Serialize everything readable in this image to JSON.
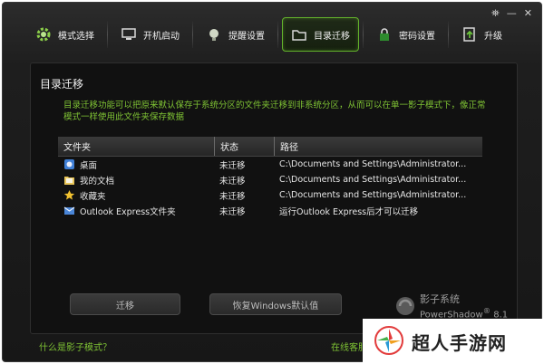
{
  "window_controls": {
    "menu": "⛯",
    "minimize": "—",
    "close": "✕"
  },
  "toolbar": {
    "items": [
      {
        "label": "模式选择",
        "icon": "gear-icon"
      },
      {
        "label": "开机启动",
        "icon": "monitor-icon"
      },
      {
        "label": "提醒设置",
        "icon": "bulb-icon"
      },
      {
        "label": "目录迁移",
        "icon": "folder-icon",
        "active": true
      },
      {
        "label": "密码设置",
        "icon": "lock-icon"
      },
      {
        "label": "升级",
        "icon": "upgrade-icon"
      }
    ]
  },
  "panel": {
    "title": "目录迁移",
    "description": "目录迁移功能可以把原来默认保存于系统分区的文件夹迁移到非系统分区，从而可以在单一影子模式下，像正常模式一样使用此文件夹保存数据"
  },
  "table": {
    "columns": [
      "文件夹",
      "状态",
      "路径"
    ],
    "rows": [
      {
        "name": "桌面",
        "status": "未迁移",
        "path": "C:\\Documents and Settings\\Administrator...",
        "icon": "desktop-icon"
      },
      {
        "name": "我的文档",
        "status": "未迁移",
        "path": "C:\\Documents and Settings\\Administrator...",
        "icon": "documents-icon"
      },
      {
        "name": "收藏夹",
        "status": "未迁移",
        "path": "C:\\Documents and Settings\\Administrator...",
        "icon": "star-icon"
      },
      {
        "name": "Outlook Express文件夹",
        "status": "未迁移",
        "path": "运行Outlook Express后才可以迁移",
        "icon": "outlook-icon"
      }
    ]
  },
  "buttons": {
    "migrate": "迁移",
    "restore": "恢复Windows默认值"
  },
  "brand": {
    "name_cn": "影子系统",
    "name_en": "PowerShadow",
    "version": "8.1",
    "mark": "®"
  },
  "footer": {
    "left_link": "什么是影子模式？",
    "right_link": "在线客服"
  },
  "watermark": {
    "text": "超人手游网"
  },
  "colors": {
    "accent": "#7fc334",
    "active_border": "#63b32b",
    "background": "#1b1b1b"
  }
}
